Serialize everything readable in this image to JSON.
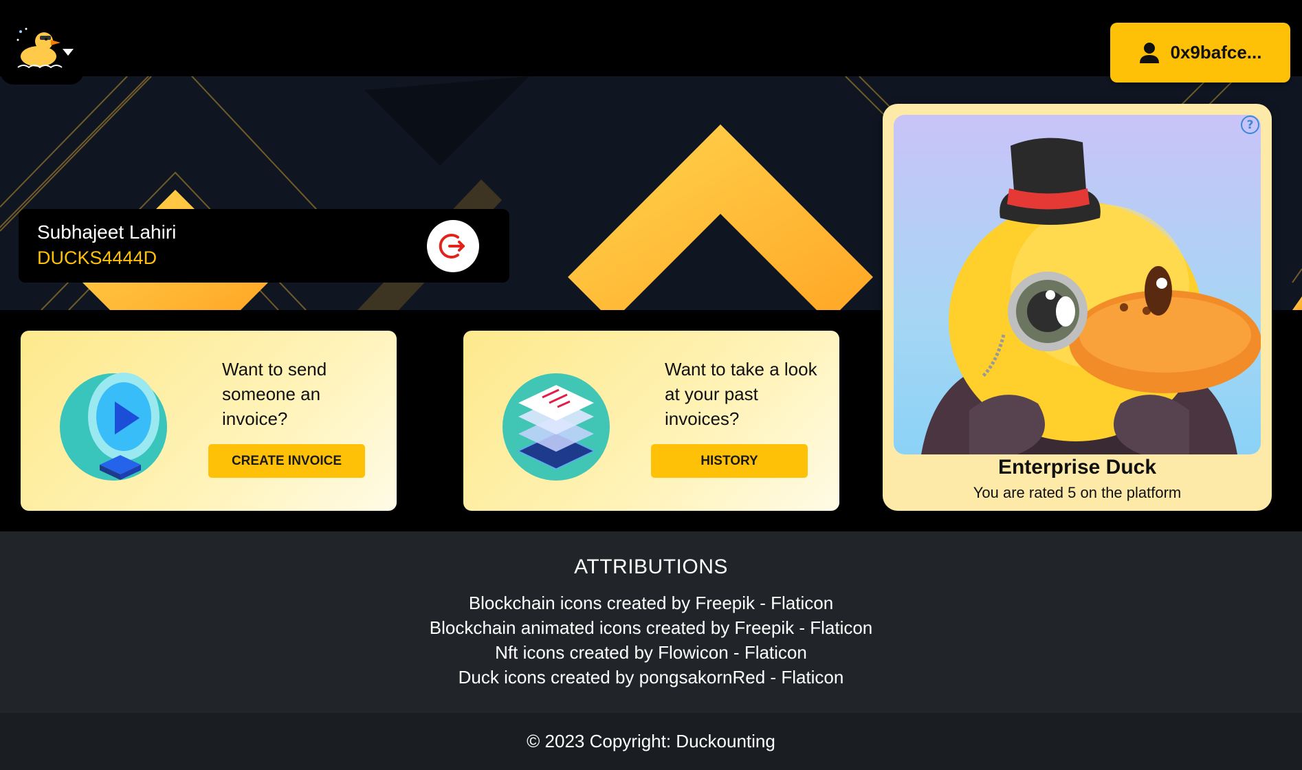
{
  "header": {
    "logo_menu_icon": "duck-logo-icon",
    "wallet_label": "0x9bafce..."
  },
  "profile": {
    "name": "Subhajeet Lahiri",
    "id": "DUCKS4444D",
    "logout_icon": "logout-icon"
  },
  "cards": [
    {
      "text": "Want to send someone an invoice?",
      "button": "CREATE INVOICE",
      "illustration": "blockchain-play-icon"
    },
    {
      "text": "Want to take a look at your past invoices?",
      "button": "HISTORY",
      "illustration": "blockchain-layers-icon"
    }
  ],
  "nft": {
    "title": "Enterprise Duck",
    "subtitle": "You are rated 5 on the platform",
    "help_icon": "?"
  },
  "attributions": {
    "title": "ATTRIBUTIONS",
    "items": [
      "Blockchain icons created by Freepik - Flaticon",
      "Blockchain animated icons created by Freepik - Flaticon",
      "Nft icons created by Flowicon - Flaticon",
      "Duck icons created by pongsakornRed - Flaticon"
    ]
  },
  "footer": {
    "copyright": "© 2023 Copyright: Duckounting"
  },
  "colors": {
    "accent": "#FFC107",
    "hero_bg": "#0f1622",
    "attrib_bg": "#212529",
    "footer_bg": "#1a1e22"
  }
}
